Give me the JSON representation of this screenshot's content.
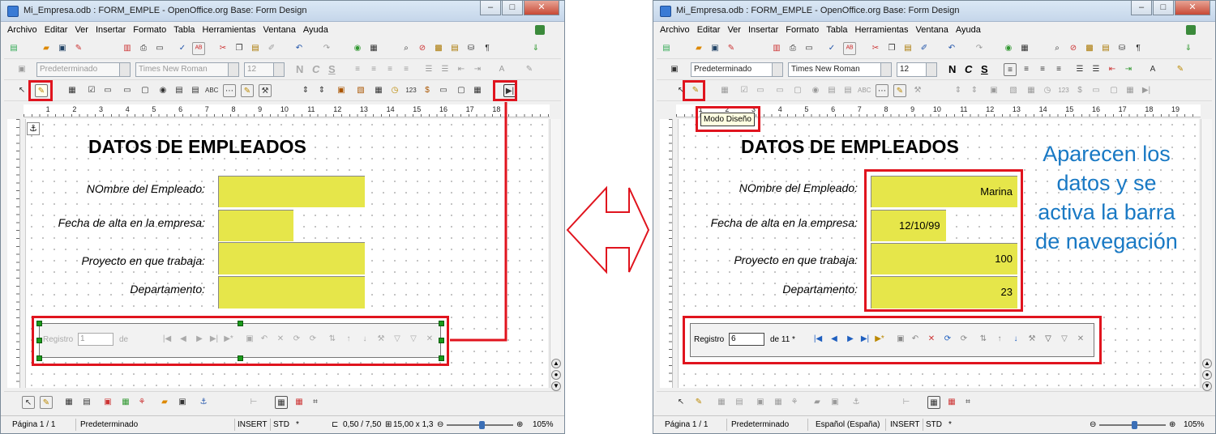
{
  "left_window": {
    "title": "Mi_Empresa.odb : FORM_EMPLE - OpenOffice.org Base: Form Design",
    "menu": [
      "Archivo",
      "Editar",
      "Ver",
      "Insertar",
      "Formato",
      "Tabla",
      "Herramientas",
      "Ventana",
      "Ayuda"
    ],
    "style_combo": "Predeterminado",
    "font_combo": "Times New Roman",
    "size_combo": "12",
    "ruler_numbers": [
      "1",
      "2",
      "3",
      "4",
      "5",
      "6",
      "7",
      "8",
      "9",
      "10",
      "11",
      "12",
      "13",
      "14",
      "15",
      "16",
      "17",
      "18"
    ],
    "form": {
      "heading": "DATOS DE EMPLEADOS",
      "labels": [
        "NOmbre del Empleado:",
        "Fecha de alta en la empresa:",
        "Proyecto en que trabaja:",
        "Departamento:"
      ],
      "values": [
        "",
        "",
        "",
        ""
      ]
    },
    "navbar": {
      "registro_label": "Registro",
      "registro_value": "1",
      "de_label": "de"
    },
    "status": {
      "page": "Página 1 / 1",
      "style": "Predeterminado",
      "insert": "INSERT",
      "std": "STD",
      "star": "*",
      "position": "0,50 / 7,50",
      "size": "15,00 x 1,3",
      "zoom": "105%"
    }
  },
  "right_window": {
    "title": "Mi_Empresa.odb : FORM_EMPLE - OpenOffice.org Base: Form Design",
    "menu": [
      "Archivo",
      "Editar",
      "Ver",
      "Insertar",
      "Formato",
      "Tabla",
      "Herramientas",
      "Ventana",
      "Ayuda"
    ],
    "style_combo": "Predeterminado",
    "font_combo": "Times New Roman",
    "size_combo": "12",
    "tooltip": "Modo Diseño",
    "ruler_numbers": [
      "1",
      "2",
      "3",
      "4",
      "5",
      "6",
      "7",
      "8",
      "9",
      "10",
      "11",
      "12",
      "13",
      "14",
      "15",
      "16",
      "17",
      "18",
      "19"
    ],
    "form": {
      "heading": "DATOS DE EMPLEADOS",
      "labels": [
        "NOmbre del Empleado:",
        "Fecha de alta en la empresa:",
        "Proyecto en que trabaja:",
        "Departamento:"
      ],
      "values": [
        "Marina",
        "12/10/99",
        "100",
        "23"
      ]
    },
    "navbar": {
      "registro_label": "Registro",
      "registro_value": "6",
      "de_label": "de 11 *"
    },
    "status": {
      "page": "Página 1 / 1",
      "style": "Predeterminado",
      "language": "Español (España)",
      "insert": "INSERT",
      "std": "STD",
      "star": "*",
      "zoom": "105%"
    }
  },
  "annotation": "Aparecen los datos y se activa la barra de navegación",
  "colors": {
    "field": "#e6e64a",
    "highlight": "#e0141e",
    "note": "#1979c4"
  }
}
